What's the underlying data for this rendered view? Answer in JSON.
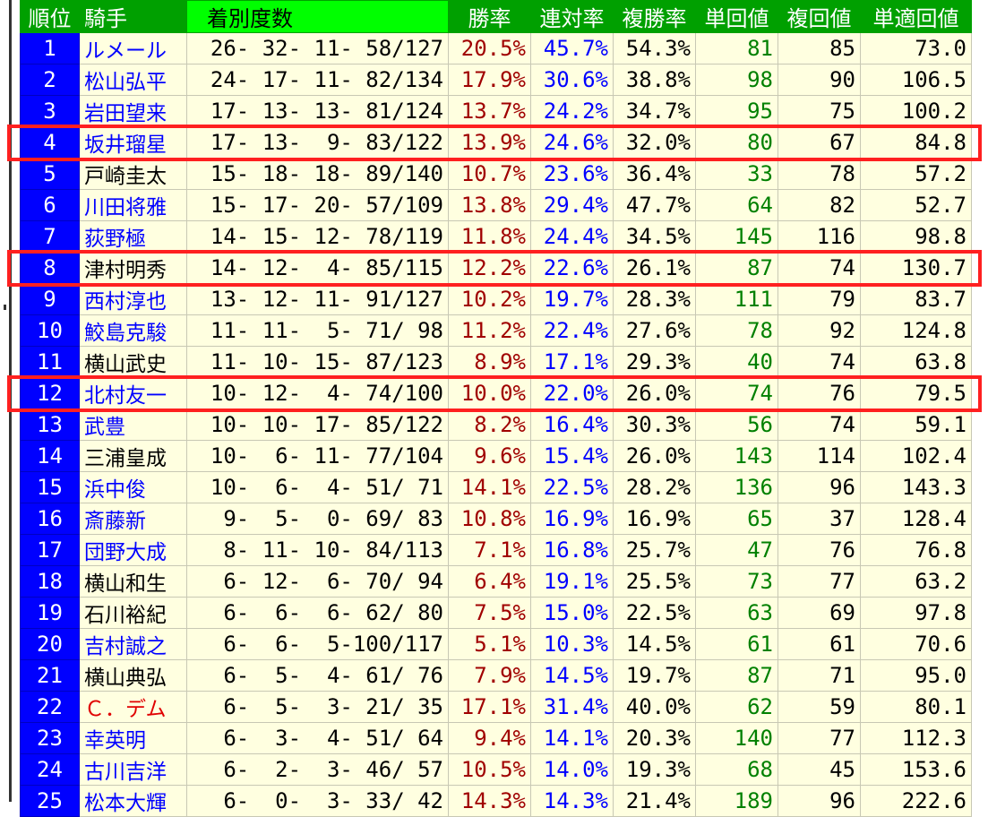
{
  "headers": {
    "rank": "順位",
    "jockey": "騎手",
    "record": "着別度数",
    "win_rate": "勝率",
    "quinella_rate": "連対率",
    "show_rate": "複勝率",
    "win_return": "単回値",
    "show_return": "複回値",
    "adj_win_return": "単適回値"
  },
  "rows": [
    {
      "rank": "1",
      "name": "ルメール",
      "name_color": "blue",
      "record": "26- 32- 11- 58/127",
      "win": "20.5%",
      "ren": "45.7%",
      "fuku": "54.3%",
      "tan": "81",
      "fk": "85",
      "tt": "73.0"
    },
    {
      "rank": "2",
      "name": "松山弘平",
      "name_color": "blue",
      "record": "24- 17- 11- 82/134",
      "win": "17.9%",
      "ren": "30.6%",
      "fuku": "38.8%",
      "tan": "98",
      "fk": "90",
      "tt": "106.5"
    },
    {
      "rank": "3",
      "name": "岩田望来",
      "name_color": "blue",
      "record": "17- 13- 13- 81/124",
      "win": "13.7%",
      "ren": "24.2%",
      "fuku": "34.7%",
      "tan": "95",
      "fk": "75",
      "tt": "100.2"
    },
    {
      "rank": "4",
      "name": "坂井瑠星",
      "name_color": "blue",
      "record": "17- 13-  9- 83/122",
      "win": "13.9%",
      "ren": "24.6%",
      "fuku": "32.0%",
      "tan": "80",
      "fk": "67",
      "tt": "84.8"
    },
    {
      "rank": "5",
      "name": "戸崎圭太",
      "name_color": "black",
      "record": "15- 18- 18- 89/140",
      "win": "10.7%",
      "ren": "23.6%",
      "fuku": "36.4%",
      "tan": "33",
      "fk": "78",
      "tt": "57.2"
    },
    {
      "rank": "6",
      "name": "川田将雅",
      "name_color": "blue",
      "record": "15- 17- 20- 57/109",
      "win": "13.8%",
      "ren": "29.4%",
      "fuku": "47.7%",
      "tan": "64",
      "fk": "82",
      "tt": "52.7"
    },
    {
      "rank": "7",
      "name": "荻野極",
      "name_color": "blue",
      "record": "14- 15- 12- 78/119",
      "win": "11.8%",
      "ren": "24.4%",
      "fuku": "34.5%",
      "tan": "145",
      "fk": "116",
      "tt": "98.8"
    },
    {
      "rank": "8",
      "name": "津村明秀",
      "name_color": "black",
      "record": "14- 12-  4- 85/115",
      "win": "12.2%",
      "ren": "22.6%",
      "fuku": "26.1%",
      "tan": "87",
      "fk": "74",
      "tt": "130.7"
    },
    {
      "rank": "9",
      "name": "西村淳也",
      "name_color": "blue",
      "record": "13- 12- 11- 91/127",
      "win": "10.2%",
      "ren": "19.7%",
      "fuku": "28.3%",
      "tan": "111",
      "fk": "79",
      "tt": "83.7"
    },
    {
      "rank": "10",
      "name": "鮫島克駿",
      "name_color": "blue",
      "record": "11- 11-  5- 71/ 98",
      "win": "11.2%",
      "ren": "22.4%",
      "fuku": "27.6%",
      "tan": "78",
      "fk": "92",
      "tt": "124.8"
    },
    {
      "rank": "11",
      "name": "横山武史",
      "name_color": "black",
      "record": "11- 10- 15- 87/123",
      "win": "8.9%",
      "ren": "17.1%",
      "fuku": "29.3%",
      "tan": "40",
      "fk": "74",
      "tt": "63.8"
    },
    {
      "rank": "12",
      "name": "北村友一",
      "name_color": "blue",
      "record": "10- 12-  4- 74/100",
      "win": "10.0%",
      "ren": "22.0%",
      "fuku": "26.0%",
      "tan": "74",
      "fk": "76",
      "tt": "79.5"
    },
    {
      "rank": "13",
      "name": "武豊",
      "name_color": "blue",
      "record": "10- 10- 17- 85/122",
      "win": "8.2%",
      "ren": "16.4%",
      "fuku": "30.3%",
      "tan": "56",
      "fk": "74",
      "tt": "59.1"
    },
    {
      "rank": "14",
      "name": "三浦皇成",
      "name_color": "black",
      "record": "10-  6- 11- 77/104",
      "win": "9.6%",
      "ren": "15.4%",
      "fuku": "26.0%",
      "tan": "143",
      "fk": "114",
      "tt": "102.4"
    },
    {
      "rank": "15",
      "name": "浜中俊",
      "name_color": "blue",
      "record": "10-  6-  4- 51/ 71",
      "win": "14.1%",
      "ren": "22.5%",
      "fuku": "28.2%",
      "tan": "136",
      "fk": "96",
      "tt": "143.3"
    },
    {
      "rank": "16",
      "name": "斎藤新",
      "name_color": "blue",
      "record": " 9-  5-  0- 69/ 83",
      "win": "10.8%",
      "ren": "16.9%",
      "fuku": "16.9%",
      "tan": "65",
      "fk": "37",
      "tt": "128.4"
    },
    {
      "rank": "17",
      "name": "団野大成",
      "name_color": "blue",
      "record": " 8- 11- 10- 84/113",
      "win": "7.1%",
      "ren": "16.8%",
      "fuku": "25.7%",
      "tan": "47",
      "fk": "76",
      "tt": "76.8"
    },
    {
      "rank": "18",
      "name": "横山和生",
      "name_color": "black",
      "record": " 6- 12-  6- 70/ 94",
      "win": "6.4%",
      "ren": "19.1%",
      "fuku": "25.5%",
      "tan": "73",
      "fk": "77",
      "tt": "63.2"
    },
    {
      "rank": "19",
      "name": "石川裕紀",
      "name_color": "black",
      "record": " 6-  6-  6- 62/ 80",
      "win": "7.5%",
      "ren": "15.0%",
      "fuku": "22.5%",
      "tan": "63",
      "fk": "69",
      "tt": "97.8"
    },
    {
      "rank": "20",
      "name": "吉村誠之",
      "name_color": "blue",
      "record": " 6-  6-  5-100/117",
      "win": "5.1%",
      "ren": "10.3%",
      "fuku": "14.5%",
      "tan": "61",
      "fk": "61",
      "tt": "70.6"
    },
    {
      "rank": "21",
      "name": "横山典弘",
      "name_color": "black",
      "record": " 6-  5-  4- 61/ 76",
      "win": "7.9%",
      "ren": "14.5%",
      "fuku": "19.7%",
      "tan": "87",
      "fk": "71",
      "tt": "95.0"
    },
    {
      "rank": "22",
      "name": "Ｃ．デム",
      "name_color": "red",
      "record": " 6-  5-  3- 21/ 35",
      "win": "17.1%",
      "ren": "31.4%",
      "fuku": "40.0%",
      "tan": "62",
      "fk": "59",
      "tt": "80.1"
    },
    {
      "rank": "23",
      "name": "幸英明",
      "name_color": "blue",
      "record": " 6-  3-  4- 51/ 64",
      "win": "9.4%",
      "ren": "14.1%",
      "fuku": "20.3%",
      "tan": "140",
      "fk": "77",
      "tt": "112.3"
    },
    {
      "rank": "24",
      "name": "古川吉洋",
      "name_color": "blue",
      "record": " 6-  2-  3- 46/ 57",
      "win": "10.5%",
      "ren": "14.0%",
      "fuku": "19.3%",
      "tan": "68",
      "fk": "45",
      "tt": "153.6"
    },
    {
      "rank": "25",
      "name": "松本大輝",
      "name_color": "blue",
      "record": " 6-  0-  3- 33/ 42",
      "win": "14.3%",
      "ren": "14.3%",
      "fuku": "21.4%",
      "tan": "189",
      "fk": "96",
      "tt": "222.6"
    }
  ],
  "highlighted_ranks": [
    "4",
    "8",
    "12"
  ],
  "colors": {
    "header_bg": "#00a000",
    "header_highlight_bg": "#00ff00",
    "rank_bg": "#0000ff",
    "cell_bg": "#ffffe0",
    "win_rate": "#a00000",
    "quinella_rate": "#0000ff",
    "win_return": "#008000",
    "highlight_box": "#ff2020"
  }
}
